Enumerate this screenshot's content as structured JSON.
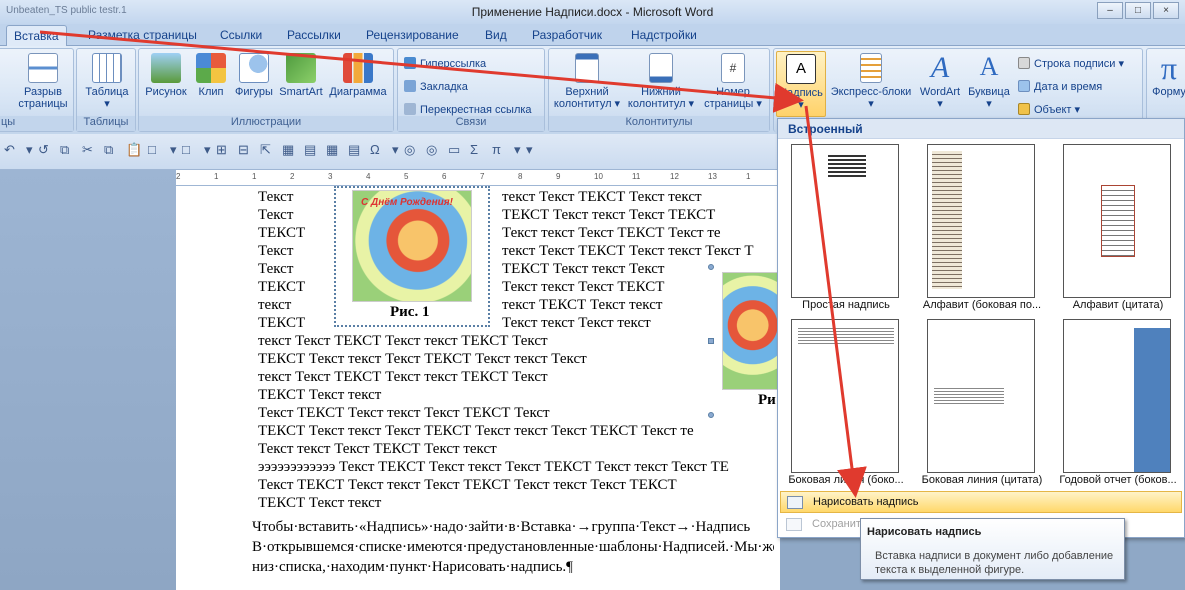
{
  "window": {
    "title": "Применение Надписи.docx - Microsoft Word",
    "left_fragment": "Unbeaten_TS public testr.1",
    "controls": [
      "–",
      "□",
      "×"
    ]
  },
  "tabs": [
    {
      "label": "Вставка",
      "active": true
    },
    {
      "label": "Разметка страницы"
    },
    {
      "label": "Ссылки"
    },
    {
      "label": "Рассылки"
    },
    {
      "label": "Рецензирование"
    },
    {
      "label": "Вид"
    },
    {
      "label": "Разработчик"
    },
    {
      "label": "Надстройки"
    }
  ],
  "ribbon": {
    "pages_partial": {
      "line1": "Разрыв",
      "line2": "страницы",
      "label_cut": "цы"
    },
    "tables": {
      "btn": "Таблица",
      "group": "Таблицы"
    },
    "illustrations": {
      "group": "Иллюстрации",
      "buttons": [
        "Рисунок",
        "Клип",
        "Фигуры",
        "SmartArt",
        "Диаграмма"
      ]
    },
    "links": {
      "group": "Связи",
      "items": [
        "Гиперссылка",
        "Закладка",
        "Перекрестная ссылка"
      ]
    },
    "headers": {
      "group": "Колонтитулы",
      "buttons": [
        {
          "l1": "Верхний",
          "l2": "колонтитул ▾"
        },
        {
          "l1": "Нижний",
          "l2": "колонтитул ▾"
        },
        {
          "l1": "Номер",
          "l2": "страницы ▾"
        }
      ]
    },
    "text": {
      "buttons": [
        {
          "l1": "Надпись",
          "l2": "▾"
        },
        {
          "l1": "Экспресс-блоки",
          "l2": "▾"
        },
        {
          "l1": "WordArt",
          "l2": "▾"
        },
        {
          "l1": "Буквица",
          "l2": "▾"
        }
      ],
      "small": [
        "Строка подписи ▾",
        "Дата и время",
        "Объект ▾"
      ]
    },
    "symbols": {
      "btn": "Форму"
    }
  },
  "quick_access": [
    "↶",
    "▾",
    "↺",
    "⧉",
    "✂",
    "⧉",
    "📋",
    "□",
    "▾",
    "□",
    "▾",
    "⊞",
    "⊟",
    "⇱",
    "▦",
    "▤",
    "▦",
    "▤",
    "Ω",
    "▾",
    "◎",
    "◎",
    "▭",
    "Σ",
    "π",
    "▾",
    "▾"
  ],
  "ruler_marks": [
    "2",
    "1",
    "1",
    "2",
    "3",
    "4",
    "5",
    "6",
    "7",
    "8",
    "9",
    "10",
    "11",
    "12",
    "13",
    "1"
  ],
  "document": {
    "left_col": [
      {
        "t": "Текст",
        "c": "it"
      },
      {
        "t": "Текст",
        "c": ""
      },
      {
        "t": "ТЕКСТ",
        "c": "bd"
      },
      {
        "t": "Текст",
        "c": "it"
      },
      {
        "t": "Текст",
        "c": ""
      },
      {
        "t": "ТЕКСТ",
        "c": "bd"
      },
      {
        "t": "текст",
        "c": ""
      },
      {
        "t": "ТЕКСТ",
        "c": "bd"
      }
    ],
    "mid_col": [
      "текст Текст ТЕКСТ Текст текст",
      "ТЕКСТ  Текст  текст  Текст  ТЕКСТ",
      "Текст  текст  Текст  ТЕКСТ  Текст  те",
      "текст Текст ТЕКСТ Текст текст Текст Т",
      "ТЕКСТ  Текст  текст  Текст",
      "Текст  текст  Текст  ТЕКСТ",
      "текст  ТЕКСТ  Текст  текст",
      "Текст  текст  Текст  текст"
    ],
    "full_lines": [
      "текст  Текст  ТЕКСТ  Текст  текст  ТЕКСТ  Текст",
      "ТЕКСТ Текст текст Текст ТЕКСТ Текст текст Текст",
      "текст  Текст  ТЕКСТ  Текст  текст  ТЕКСТ  Текст",
      "ТЕКСТ Текст текст",
      "Текст  ТЕКСТ  Текст  текст  Текст  ТЕКСТ  Текст",
      "ТЕКСТ  Текст  текст  Текст  ТЕКСТ  Текст  текст  Текст  ТЕКСТ  Текст  те",
      "Текст текст Текст ТЕКСТ Текст текст",
      "ээээээээээээ Текст ТЕКСТ Текст текст Текст ТЕКСТ Текст текст Текст ТЕ",
      "Текст  ТЕКСТ  Текст  текст  Текст  ТЕКСТ  Текст  текст  Текст  ТЕКСТ",
      "ТЕКСТ Текст текст"
    ],
    "para": [
      "Чтобы·вставить·«Надпись»·надо·зайти·в·Вставка·→группа·Текст→·Надпись",
      "В·открывшемся·списке·имеются·предустановленные·шаблоны·Надписей.·Мы·же·перех",
      "низ·списка,·находим·пункт·Нарисовать·надпись.¶"
    ],
    "caption1": "Рис. 1",
    "caption2": "Ри",
    "card_text": "С Днём Рождения!"
  },
  "dropdown": {
    "header": "Встроенный",
    "thumbs": [
      "Простая надпись",
      "Алфавит (боковая по...",
      "Алфавит (цитата)",
      "Боковая линия (боко...",
      "Боковая линия (цитата)",
      "Годовой отчет (боков..."
    ],
    "menu": [
      {
        "label": "Нарисовать надпись",
        "state": "hi"
      },
      {
        "label": "Сохранить",
        "state": "dis"
      }
    ]
  },
  "tooltip": {
    "title": "Нарисовать надпись",
    "desc": "Вставка надписи в документ либо добавление текста к выделенной фигуре."
  },
  "colors": {
    "arrow": "#e03a2e",
    "ribbon": "#cfdff2",
    "highlight": "#ffd86b"
  }
}
